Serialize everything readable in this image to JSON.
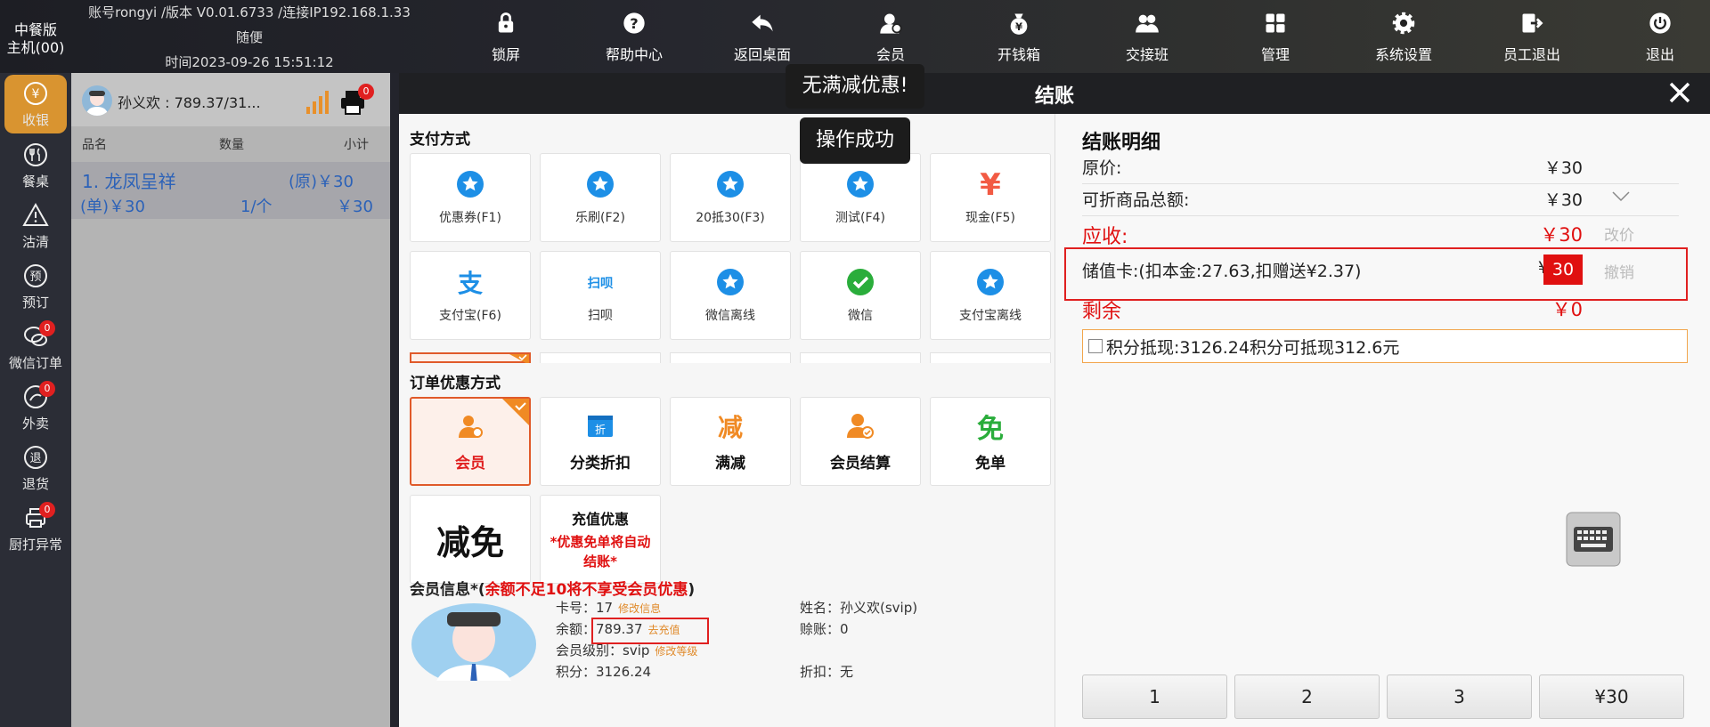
{
  "brand": {
    "line1": "中餐版",
    "line2": "主机(00)"
  },
  "account": {
    "line1": "账号rongyi /版本 V0.01.6733 /连接IP192.168.1.33",
    "line2": "随便",
    "line3": "时间2023-09-26 15:51:12"
  },
  "toolbar": [
    {
      "label": "锁屏",
      "icon": "lock-icon"
    },
    {
      "label": "帮助中心",
      "icon": "help-icon"
    },
    {
      "label": "返回桌面",
      "icon": "back-icon"
    },
    {
      "label": "会员",
      "icon": "member-icon"
    },
    {
      "label": "开钱箱",
      "icon": "cashbox-icon"
    },
    {
      "label": "交接班",
      "icon": "shift-icon"
    },
    {
      "label": "管理",
      "icon": "manage-icon"
    },
    {
      "label": "系统设置",
      "icon": "gear-icon"
    },
    {
      "label": "员工退出",
      "icon": "logout-icon"
    },
    {
      "label": "退出",
      "icon": "power-icon"
    }
  ],
  "sidenav": [
    {
      "label": "收银",
      "icon": "yen-icon",
      "active": true
    },
    {
      "label": "餐桌",
      "icon": "cutlery-icon"
    },
    {
      "label": "沽清",
      "icon": "warning-icon"
    },
    {
      "label": "预订",
      "icon": "reserve-icon"
    },
    {
      "label": "微信订单",
      "icon": "wechat-order-icon",
      "badge": "0"
    },
    {
      "label": "外卖",
      "icon": "takeout-icon",
      "badge": "0"
    },
    {
      "label": "退货",
      "icon": "return-icon"
    },
    {
      "label": "厨打异常",
      "icon": "kitchen-print-icon",
      "badge": "0"
    }
  ],
  "order": {
    "member": "孙义欢 : 789.37/31...",
    "printer_badge": "0",
    "cols": {
      "name": "品名",
      "qty": "数量",
      "subtotal": "小计"
    },
    "item": {
      "name": "1. 龙凤呈祥",
      "orig": "(原)￥30",
      "unit": "(单)￥30",
      "qty": "1/个",
      "subtotal": "￥30"
    }
  },
  "dialog": {
    "title": "结账",
    "pay_title": "支付方式",
    "pay_methods": [
      {
        "label": "优惠券(F1)",
        "icon": "star-icon"
      },
      {
        "label": "乐刷(F2)",
        "icon": "star-icon"
      },
      {
        "label": "20抵30(F3)",
        "icon": "star-icon"
      },
      {
        "label": "测试(F4)",
        "icon": "star-icon"
      },
      {
        "label": "现金(F5)",
        "icon": "yen-icon"
      },
      {
        "label": "支付宝(F6)",
        "icon": "alipay-icon"
      },
      {
        "label": "扫呗",
        "icon": "saobei-icon"
      },
      {
        "label": "微信离线",
        "icon": "star-icon"
      },
      {
        "label": "微信",
        "icon": "wechat-icon"
      },
      {
        "label": "支付宝离线",
        "icon": "star-icon"
      }
    ],
    "saobei_text": "扫呗",
    "discount_title": "订单优惠方式",
    "discounts": [
      {
        "label": "会员",
        "icon": "member-icon",
        "selected": true
      },
      {
        "label": "分类折扣",
        "icon": "discount-icon"
      },
      {
        "label": "满减",
        "icon": "full-reduce-icon",
        "glyph": "减"
      },
      {
        "label": "会员结算",
        "icon": "member-settle-icon"
      },
      {
        "label": "免单",
        "icon": "free-icon",
        "glyph": "免"
      }
    ],
    "reduce_free": "减免",
    "recharge": {
      "title": "充值优惠",
      "note": "*优惠免单将自动结账*"
    },
    "member_info": {
      "title": "会员信息*(",
      "warn": "余额不足10将不享受会员优惠",
      "close": ")"
    },
    "member": {
      "card_label": "卡号：",
      "card": "17",
      "edit_info": "修改信息",
      "balance_label": "余额：",
      "balance": "789.37",
      "recharge_link": "去充值",
      "level_label": "会员级别：",
      "level": "svip",
      "edit_level": "修改等级",
      "points_label": "积分：",
      "points": "3126.24",
      "name_label": "姓名：",
      "name": "孙义欢(svip)",
      "credit_label": "赊账：",
      "credit": "0",
      "discount_label": "折扣：",
      "discount": "无"
    },
    "toast1": "无满减优惠!",
    "toast2": "操作成功",
    "detail": {
      "title": "结账明细",
      "orig_label": "原价:",
      "orig": "￥30",
      "discountable_label": "可折商品总额:",
      "discountable": "￥30",
      "due_label": "应收:",
      "due": "￥30",
      "change_price": "改价",
      "card_label": "储值卡:(扣本金:27.63,扣赠送¥2.37)",
      "card_currency": "¥",
      "card_value": "30",
      "cancel": "撤销",
      "remain_label": "剩余",
      "remain": "￥0",
      "points_text": "积分抵现:3126.24积分可抵现312.6元"
    },
    "numpad": [
      "1",
      "2",
      "3",
      "¥30"
    ]
  }
}
